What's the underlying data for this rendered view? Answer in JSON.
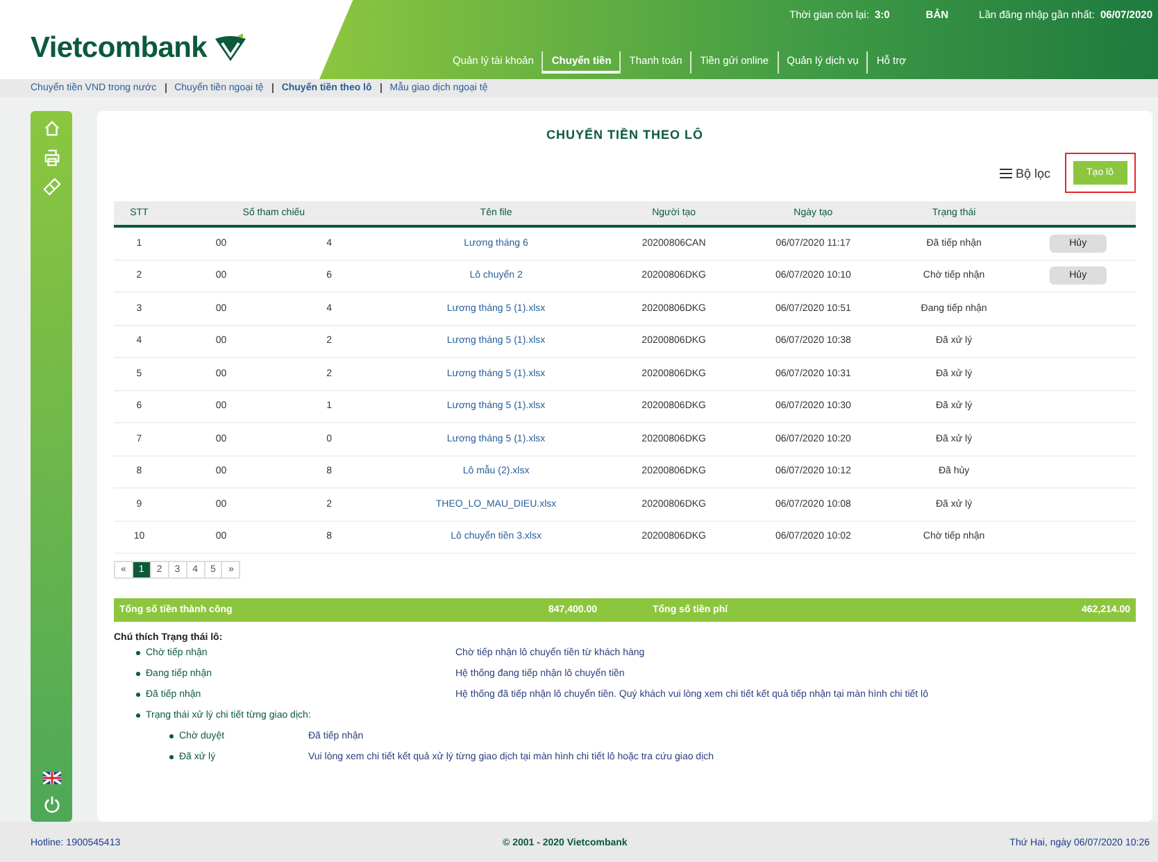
{
  "header": {
    "logo": "Vietcombank",
    "session": [
      {
        "label": "Thời gian còn lại:",
        "value": "3:0"
      },
      {
        "value": "BẢN"
      },
      {
        "label": "Lần đăng nhập gần nhất:",
        "value": "06/07/2020"
      }
    ],
    "nav": [
      {
        "label": "Quản lý tài khoản",
        "selected": false
      },
      {
        "label": "Chuyển tiền",
        "selected": true
      },
      {
        "label": "Thanh toán",
        "selected": false
      },
      {
        "label": "Tiền gửi online",
        "selected": false
      },
      {
        "label": "Quản lý dịch vụ",
        "selected": false
      },
      {
        "label": "Hỗ trợ",
        "selected": false
      }
    ]
  },
  "subnav": [
    {
      "label": "Chuyển tiền VND trong nước",
      "selected": false
    },
    {
      "label": "Chuyển tiền ngoại tệ",
      "selected": false
    },
    {
      "label": "Chuyển tiền theo lô",
      "selected": true
    },
    {
      "label": "Mẫu giao dịch ngoại tệ",
      "selected": false
    }
  ],
  "page_title": "CHUYỂN TIỀN THEO LÔ",
  "filter": "Bộ lọc",
  "create_button": "Tạo lô",
  "table": {
    "columns": [
      "STT",
      "Số tham chiếu",
      "Tên file",
      "Người tạo",
      "Ngày tạo",
      "Trạng thái"
    ],
    "rows": [
      {
        "cells": [
          "1",
          "00 4",
          "Lương tháng 6",
          "20200806CAN",
          "06/07/2020 11:17",
          "Đã tiếp nhận"
        ],
        "action": "Hủy"
      },
      {
        "cells": [
          "2",
          "00 6",
          "Lô chuyển 2",
          "20200806DKG",
          "06/07/2020 10:10",
          "Chờ tiếp nhận"
        ],
        "action": "Hủy"
      },
      {
        "cells": [
          "3",
          "00 4",
          "Lương tháng 5 (1).xlsx",
          "20200806DKG",
          "06/07/2020 10:51",
          "Đang tiếp nhận"
        ]
      },
      {
        "cells": [
          "4",
          "00 2",
          "Lương tháng 5 (1).xlsx",
          "20200806DKG",
          "06/07/2020 10:38",
          "Đã xử lý"
        ]
      },
      {
        "cells": [
          "5",
          "00 2",
          "Lương tháng 5 (1).xlsx",
          "20200806DKG",
          "06/07/2020 10:31",
          "Đã xử lý"
        ]
      },
      {
        "cells": [
          "6",
          "00 1",
          "Lương tháng 5 (1).xlsx",
          "20200806DKG",
          "06/07/2020 10:30",
          "Đã xử lý"
        ]
      },
      {
        "cells": [
          "7",
          "00 0",
          "Lương tháng 5 (1).xlsx",
          "20200806DKG",
          "06/07/2020 10:20",
          "Đã xử lý"
        ]
      },
      {
        "cells": [
          "8",
          "00 8",
          "Lô mẫu (2).xlsx",
          "20200806DKG",
          "06/07/2020 10:12",
          "Đã hủy"
        ]
      },
      {
        "cells": [
          "9",
          "00 2",
          "THEO_LO_MAU_DIEU.xlsx",
          "20200806DKG",
          "06/07/2020 10:08",
          "Đã xử lý"
        ]
      },
      {
        "cells": [
          "10",
          "00 8",
          "Lô chuyển tiền 3.xlsx",
          "20200806DKG",
          "06/07/2020 10:02",
          "Chờ tiếp nhận"
        ]
      }
    ]
  },
  "pagination": [
    {
      "label": "«",
      "selected": false
    },
    {
      "label": "1",
      "selected": true
    },
    {
      "label": "2",
      "selected": false
    },
    {
      "label": "3",
      "selected": false
    },
    {
      "label": "4",
      "selected": false
    },
    {
      "label": "5",
      "selected": false
    },
    {
      "label": "»",
      "selected": false
    }
  ],
  "summary": [
    {
      "label": "Tổng số tiền thành công",
      "value": "847,400.00"
    },
    {
      "label": "Tổng số tiền phí",
      "value": "462,214.00"
    }
  ],
  "notes": {
    "title": "Chú thích Trạng thái lô:",
    "items": [
      {
        "term": "Chờ tiếp nhận",
        "text": "Chờ tiếp nhận lô chuyển tiền từ khách hàng"
      },
      {
        "term": "Đang tiếp nhận",
        "text": "Hệ thống đang tiếp nhận lô chuyển tiền"
      },
      {
        "term": "Đã tiếp nhận",
        "text": "Hệ thống đã tiếp nhận lô chuyển tiền. Quý khách vui lòng xem chi tiết kết quả tiếp nhận tại màn hình chi tiết lô"
      },
      {
        "term": "Trạng thái xử lý chi tiết từng giao dịch:",
        "children": [
          {
            "term": "Chờ duyệt",
            "text": "Đã tiếp nhận"
          },
          {
            "term": "Đã xử lý",
            "text": "Vui lòng xem chi tiết kết quả xử lý từng giao dịch tại màn hình chi tiết lô hoặc tra cứu giao dịch"
          }
        ]
      }
    ]
  },
  "footer": {
    "hotline": "Hotline: 1900545413",
    "copyright": "© 2001 - 2020 Vietcombank",
    "date": "Thứ Hai, ngày 06/07/2020 10:26"
  }
}
